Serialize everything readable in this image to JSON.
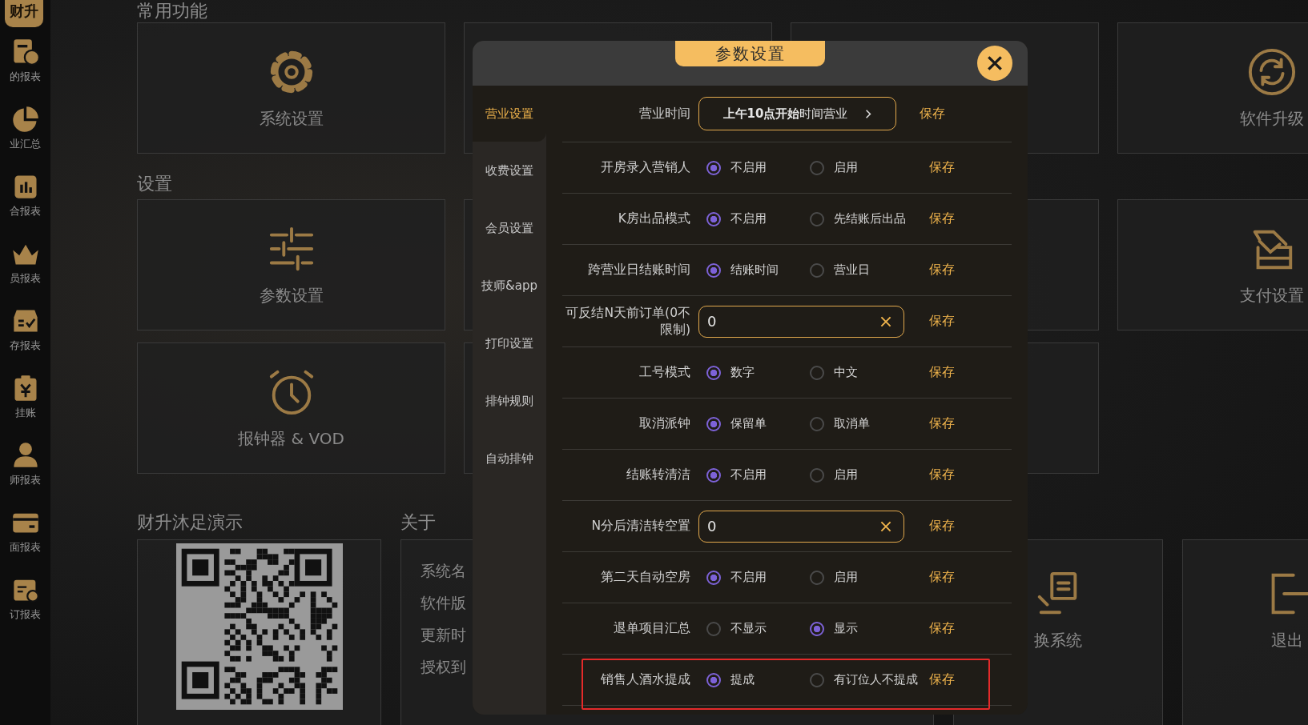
{
  "sidebar": {
    "logo": "财升",
    "items": [
      {
        "label": "的报表",
        "kind": "report"
      },
      {
        "label": "业汇总",
        "kind": "pie"
      },
      {
        "label": "合报表",
        "kind": "chart"
      },
      {
        "label": "员报表",
        "kind": "crown"
      },
      {
        "label": "存报表",
        "kind": "check"
      },
      {
        "label": "挂账",
        "kind": "clip"
      },
      {
        "label": "师报表",
        "kind": "person"
      },
      {
        "label": "面报表",
        "kind": "card"
      },
      {
        "label": "订报表",
        "kind": "calendar"
      }
    ]
  },
  "sections": [
    {
      "title": "常用功能",
      "cards": [
        {
          "label": "系统设置",
          "kind": "gear"
        },
        {
          "kind": "blank"
        },
        {
          "kind": "blank"
        },
        {
          "label": "软件升级",
          "kind": "refresh"
        }
      ]
    },
    {
      "title": "设置",
      "cards": [
        {
          "label": "参数设置",
          "kind": "sliders"
        },
        {
          "kind": "blank"
        },
        {
          "kind": "blank"
        },
        {
          "label": "支付设置",
          "kind": "tray"
        }
      ]
    },
    {
      "cards": [
        {
          "label": "报钟器 & VOD",
          "kind": "alarm"
        },
        {
          "kind": "blank"
        },
        {
          "kind": "blank"
        }
      ]
    }
  ],
  "bottom": {
    "demo_title": "财升沐足演示",
    "about_title": "关于",
    "about_items": [
      "系统名",
      "软件版",
      "更新时",
      "授权到"
    ],
    "cards": [
      {
        "label": "换系统",
        "kind": "document"
      },
      {
        "label": "退出",
        "kind": "exit"
      }
    ]
  },
  "modal": {
    "title": "参数设置",
    "nav": [
      {
        "label": "营业设置",
        "selected": true
      },
      {
        "label": "收费设置",
        "selected": false
      },
      {
        "label": "会员设置",
        "selected": false
      },
      {
        "label": "技师&app",
        "selected": false
      },
      {
        "label": "打印设置",
        "selected": false
      },
      {
        "label": "排钟规则",
        "selected": false
      },
      {
        "label": "自动排钟",
        "selected": false
      }
    ],
    "rows": [
      {
        "kind": "button",
        "label": "营业时间",
        "value": "**上午10点开始**时间营业",
        "save": "保存"
      },
      {
        "kind": "radio",
        "label": "开房录入营销人",
        "options": [
          {
            "label": "不启用",
            "selected": true
          },
          {
            "label": "启用",
            "selected": false
          }
        ],
        "save": "保存"
      },
      {
        "kind": "radio",
        "label": "K房出品模式",
        "options": [
          {
            "label": "不启用",
            "selected": true
          },
          {
            "label": "先结账后出品",
            "selected": false
          }
        ],
        "save": "保存"
      },
      {
        "kind": "radio",
        "label": "跨营业日结账时间",
        "options": [
          {
            "label": "结账时间",
            "selected": true
          },
          {
            "label": "营业日",
            "selected": false
          }
        ],
        "save": "保存"
      },
      {
        "kind": "input",
        "label": "可反结N天前订单(0不限制)",
        "value": "0",
        "save": "保存"
      },
      {
        "kind": "radio",
        "label": "工号模式",
        "options": [
          {
            "label": "数字",
            "selected": true
          },
          {
            "label": "中文",
            "selected": false
          }
        ],
        "save": "保存"
      },
      {
        "kind": "radio",
        "label": "取消派钟",
        "options": [
          {
            "label": "保留单",
            "selected": true
          },
          {
            "label": "取消单",
            "selected": false
          }
        ],
        "save": "保存"
      },
      {
        "kind": "radio",
        "label": "结账转清洁",
        "options": [
          {
            "label": "不启用",
            "selected": true
          },
          {
            "label": "启用",
            "selected": false
          }
        ],
        "save": "保存"
      },
      {
        "kind": "input",
        "label": "N分后清洁转空置",
        "value": "0",
        "save": "保存"
      },
      {
        "kind": "radio",
        "label": "第二天自动空房",
        "options": [
          {
            "label": "不启用",
            "selected": true
          },
          {
            "label": "启用",
            "selected": false
          }
        ],
        "save": "保存"
      },
      {
        "kind": "radio",
        "label": "退单项目汇总",
        "options": [
          {
            "label": "不显示",
            "selected": false
          },
          {
            "label": "显示",
            "selected": true
          }
        ],
        "save": "保存"
      },
      {
        "kind": "radio",
        "label": "销售人酒水提成",
        "options": [
          {
            "label": "提成",
            "selected": true
          },
          {
            "label": "有订位人不提成",
            "selected": false
          }
        ],
        "save": "保存",
        "highlighted": true
      }
    ]
  }
}
